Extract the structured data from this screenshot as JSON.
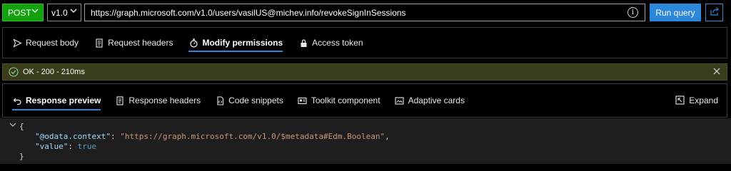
{
  "request": {
    "method": "POST",
    "version": "v1.0",
    "url": "https://graph.microsoft.com/v1.0/users/vasilUS@michev.info/revokeSignInSessions",
    "run_label": "Run query"
  },
  "request_tabs": [
    {
      "label": "Request body",
      "icon": "send-icon",
      "active": false
    },
    {
      "label": "Request headers",
      "icon": "headers-icon",
      "active": false
    },
    {
      "label": "Modify permissions",
      "icon": "permissions-icon",
      "active": true
    },
    {
      "label": "Access token",
      "icon": "lock-icon",
      "active": false
    }
  ],
  "status": {
    "text": "OK - 200 - 210ms",
    "color": "#393d1b"
  },
  "response_tabs": [
    {
      "label": "Response preview",
      "icon": "undo-arrow-icon",
      "active": true
    },
    {
      "label": "Response headers",
      "icon": "headers-icon",
      "active": false
    },
    {
      "label": "Code snippets",
      "icon": "code-file-icon",
      "active": false
    },
    {
      "label": "Toolkit component",
      "icon": "toolkit-icon",
      "active": false
    },
    {
      "label": "Adaptive cards",
      "icon": "card-icon",
      "active": false
    }
  ],
  "expand_label": "Expand",
  "response": {
    "open_brace": "{",
    "context_key": "\"@odata.context\"",
    "context_value": "\"https://graph.microsoft.com/v1.0/$metadata#Edm.Boolean\"",
    "value_key": "\"value\"",
    "value_value": "true",
    "close_brace": "}"
  },
  "colors": {
    "accent": "#2b88d8",
    "method_green": "#13a10e",
    "json_key": "#9cdcfe",
    "json_string": "#ce9178",
    "json_bool": "#569cd6"
  }
}
